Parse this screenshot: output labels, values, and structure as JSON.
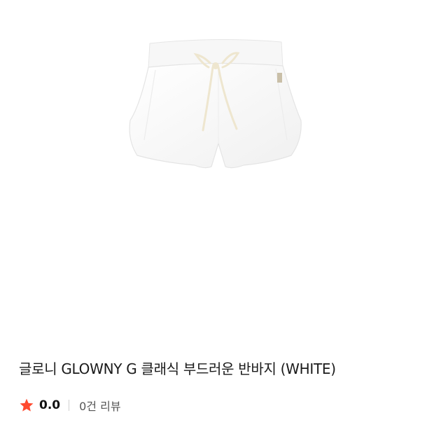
{
  "product": {
    "image_subject": "white-shorts-with-drawstring",
    "title": "글로니 GLOWNY G 클래식 부드러운 반바지 (WHITE)",
    "rating": {
      "icon": "star-icon",
      "value": "0.0",
      "review_count": "0건 리뷰"
    }
  },
  "colors": {
    "star": "#ff4a2f",
    "shorts": "#fbfbfb",
    "drawstring": "#eee6cf"
  }
}
